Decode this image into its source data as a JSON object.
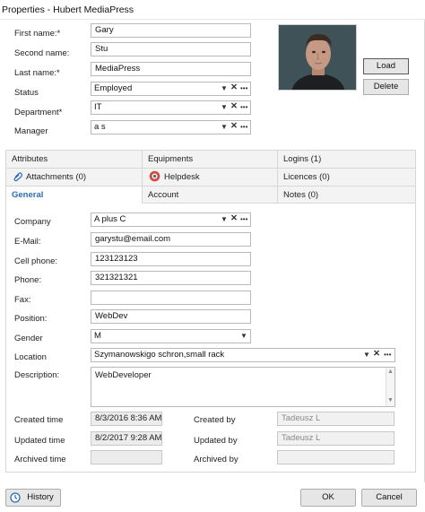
{
  "window": {
    "title": "Properties - Hubert MediaPress"
  },
  "person": {
    "first_name_label": "First name:*",
    "first_name": "Gary",
    "second_name_label": "Second name:",
    "second_name": "Stu",
    "last_name_label": "Last name:*",
    "last_name": "MediaPress",
    "status_label": "Status",
    "status": "Employed",
    "department_label": "Department*",
    "department": "IT",
    "manager_label": "Manager",
    "manager": "a s"
  },
  "photo_buttons": {
    "load": "Load",
    "delete": "Delete"
  },
  "tabs": {
    "row1": [
      "Attributes",
      "Equipments",
      "Logins (1)"
    ],
    "row2": [
      "Attachments (0)",
      "Helpdesk",
      "Licences (0)"
    ],
    "row3": [
      "General",
      "Account",
      "Notes (0)"
    ]
  },
  "general": {
    "company_label": "Company",
    "company": "A plus C",
    "email_label": "E-Mail:",
    "email": "garystu@email.com",
    "cell_label": "Cell phone:",
    "cell": "123123123",
    "phone_label": "Phone:",
    "phone": "321321321",
    "fax_label": "Fax:",
    "fax": "",
    "position_label": "Position:",
    "position": "WebDev",
    "gender_label": "Gender",
    "gender": "M",
    "location_label": "Location",
    "location": "Szymanowskigo schron,small rack",
    "description_label": "Description:",
    "description": "WebDeveloper",
    "created_time_label": "Created time",
    "created_time": "8/3/2016 8:36 AM",
    "created_by_label": "Created by",
    "created_by": "Tadeusz L",
    "updated_time_label": "Updated time",
    "updated_time": "8/2/2017 9:28 AM",
    "updated_by_label": "Updated by",
    "updated_by": "Tadeusz L",
    "archived_time_label": "Archived time",
    "archived_time": "",
    "archived_by_label": "Archived by",
    "archived_by": ""
  },
  "footer": {
    "history": "History",
    "ok": "OK",
    "cancel": "Cancel"
  },
  "colors": {
    "active_tab": "#2b6cb8",
    "helpdesk_icon": "#d64a3a"
  },
  "icons": {
    "dropdown": "chevron-down-icon",
    "clear": "close-icon",
    "more": "ellipsis-icon",
    "attachments": "paperclip-icon",
    "helpdesk": "helpdesk-icon",
    "history": "history-icon"
  }
}
